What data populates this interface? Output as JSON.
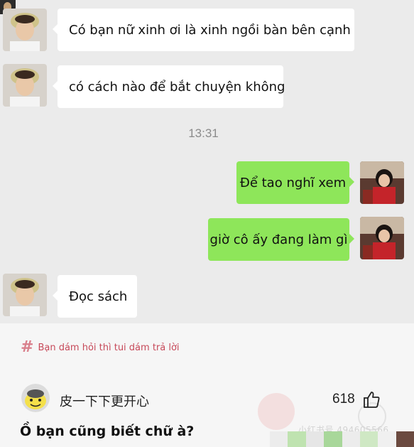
{
  "chat": {
    "messages": [
      {
        "side": "in",
        "text": "Có bạn nữ xinh ơi là xinh ngồi bàn bên cạnh"
      },
      {
        "side": "in",
        "text": "có cách nào để bắt chuyện không"
      },
      {
        "side": "out",
        "text": "Để tao nghĩ xem"
      },
      {
        "side": "out",
        "text": "giờ cô ấy đang làm gì"
      },
      {
        "side": "in",
        "text": "Đọc sách"
      }
    ],
    "timestamp": "13:31"
  },
  "topic": {
    "hashtag_symbol": "#",
    "hashtag_text": "Bạn dám hỏi thì tui dám trả lời"
  },
  "comment": {
    "username": "皮一下下更开心",
    "like_count": "618",
    "text": "Ồ bạn cũng biết chữ à?"
  },
  "watermark": {
    "text": "小红书号 494605566"
  },
  "colors": {
    "outgoing_bubble": "#8ee65a",
    "incoming_bubble": "#ffffff",
    "chat_background": "#ebebeb",
    "hashtag": "#c74a5a"
  },
  "icons": [
    "user-avatar-icon",
    "friend-avatar-icon",
    "thumbs-up-icon",
    "commenter-avatar-icon",
    "hashtag-icon"
  ]
}
